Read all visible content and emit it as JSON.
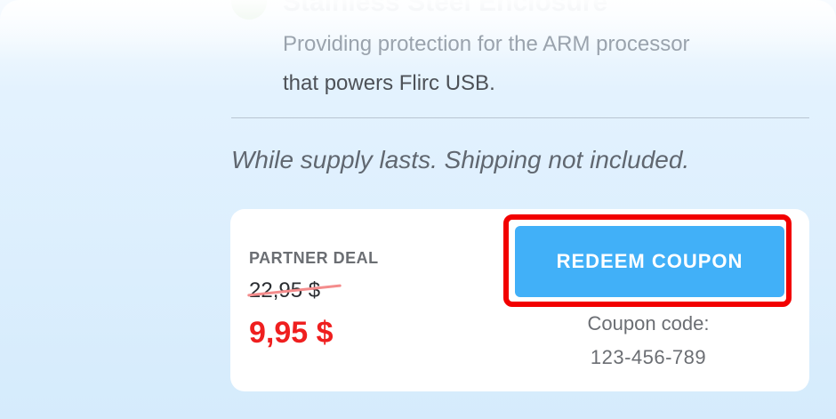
{
  "feature": {
    "icon": "check-circle-icon",
    "title": "Stainless Steel Enclosure",
    "desc_line1": "Providing protection for the ARM processor",
    "desc_line2": "that powers Flirc USB."
  },
  "notice": "While supply lasts. Shipping not included.",
  "deal": {
    "label": "PARTNER DEAL",
    "old_price": "22,95 $",
    "new_price": "9,95 $",
    "button_label": "REDEEM COUPON",
    "coupon_label": "Coupon code:",
    "coupon_code": "123-456-789"
  },
  "colors": {
    "button": "#41b0f8",
    "highlight_outline": "#f20000",
    "sale_price": "#ef1f1f"
  }
}
